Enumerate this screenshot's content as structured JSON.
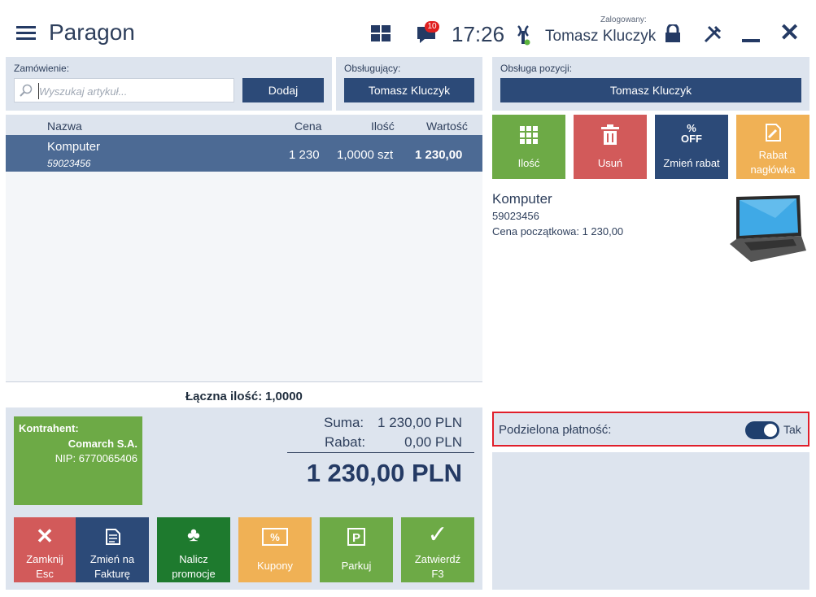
{
  "header": {
    "title": "Paragon",
    "notifications_count": "10",
    "time": "17:26",
    "logged_label": "Zalogowany:",
    "user": "Tomasz Kluczyk"
  },
  "order": {
    "label": "Zamówienie:",
    "search_placeholder": "Wyszukaj artykuł...",
    "add_button": "Dodaj"
  },
  "served": {
    "label": "Obsługujący:",
    "name": "Tomasz Kluczyk"
  },
  "position_service": {
    "label": "Obsługa pozycji:",
    "name": "Tomasz Kluczyk"
  },
  "table": {
    "columns": [
      "Nazwa",
      "Cena",
      "Ilość",
      "Wartość"
    ],
    "rows": [
      {
        "name": "Komputer",
        "code": "59023456",
        "price": "1 230",
        "qty": "1,0000 szt",
        "value": "1 230,00"
      }
    ]
  },
  "total_qty": {
    "label": "Łączna ilość:",
    "value": "1,0000"
  },
  "contractor": {
    "label": "Kontrahent:",
    "name": "Comarch S.A.",
    "nip": "NIP: 6770065406"
  },
  "summary": {
    "sum_label": "Suma:",
    "sum_value": "1 230,00 PLN",
    "discount_label": "Rabat:",
    "discount_value": "0,00 PLN",
    "total": "1 230,00 PLN"
  },
  "bottom_buttons": {
    "close": [
      "Zamknij",
      "Esc"
    ],
    "invoice": [
      "Zmień na",
      "Fakturę"
    ],
    "promo": [
      "Nalicz",
      "promocje"
    ],
    "coupons": "Kupony",
    "park": "Parkuj",
    "confirm": [
      "Zatwierdź",
      "F3"
    ]
  },
  "pos_actions": {
    "qty": "Ilość",
    "delete": "Usuń",
    "discount_icon": [
      "%",
      "OFF"
    ],
    "discount": "Zmień rabat",
    "header_discount": [
      "Rabat",
      "nagłówka"
    ]
  },
  "item_detail": {
    "name": "Komputer",
    "code": "59023456",
    "initial_price": "Cena początkowa: 1 230,00"
  },
  "split_payment": {
    "label": "Podzielona płatność:",
    "value": "Tak"
  },
  "colors": {
    "navy": "#2c4a78",
    "selected_row": "#4c6a94",
    "green": "#6daa46",
    "red": "#d25a5a",
    "orange": "#f0b155",
    "dark_green": "#1e7a2e",
    "highlight": "#e01e2a"
  },
  "icons": [
    "menu-icon",
    "tiles-icon",
    "message-icon",
    "signal-icon",
    "lock-icon",
    "tools-icon",
    "minimize-icon",
    "close-icon",
    "search-icon",
    "grid-icon",
    "trash-icon",
    "edit-icon",
    "x-icon",
    "invoice-icon",
    "clover-icon",
    "coupon-icon",
    "parking-icon",
    "check-icon",
    "laptop-icon"
  ]
}
